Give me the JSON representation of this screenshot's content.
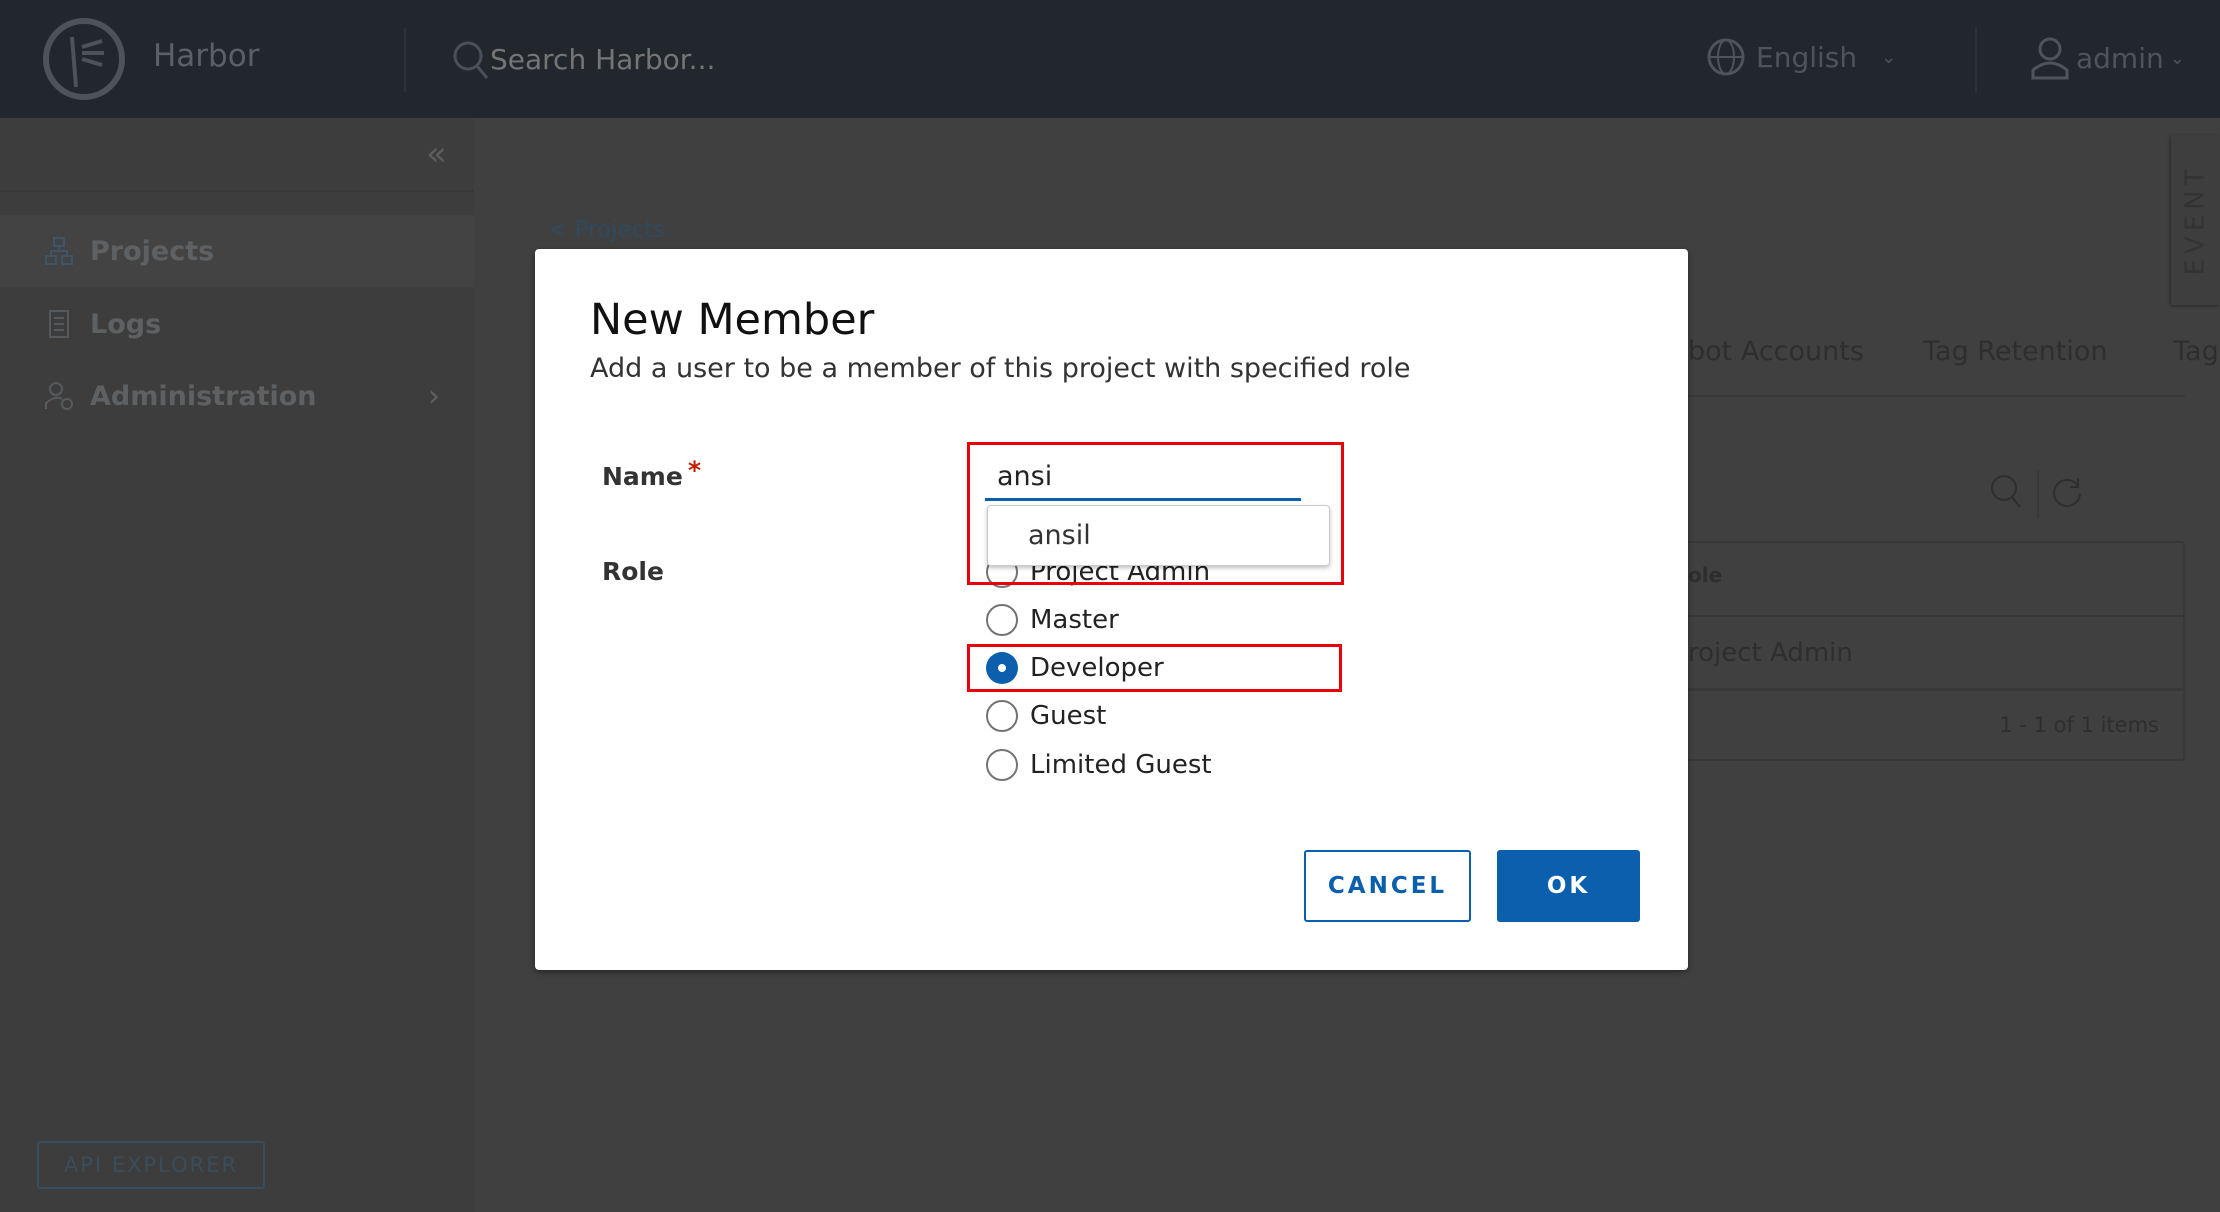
{
  "header": {
    "app_name": "Harbor",
    "search_placeholder": "Search Harbor...",
    "language": "English",
    "user": "admin"
  },
  "sidebar": {
    "items": [
      {
        "label": "Projects",
        "icon": "projects-icon"
      },
      {
        "label": "Logs",
        "icon": "logs-icon"
      },
      {
        "label": "Administration",
        "icon": "administration-icon"
      }
    ],
    "api_explorer": "API EXPLORER"
  },
  "background": {
    "breadcrumb": "< Projects",
    "event_tab": "EVENT",
    "tabs": [
      "bot Accounts",
      "Tag Retention",
      "Tag"
    ],
    "table": {
      "header_role": "ole",
      "row_role": "roject Admin",
      "footer": "1 - 1 of 1 items"
    }
  },
  "modal": {
    "title": "New Member",
    "subtitle": "Add a user to be a member of this project with specified role",
    "name_label": "Name",
    "required_mark": "*",
    "name_value": "ansi",
    "suggestion": "ansil",
    "role_label": "Role",
    "roles": [
      {
        "label": "Project Admin",
        "selected": false
      },
      {
        "label": "Master",
        "selected": false
      },
      {
        "label": "Developer",
        "selected": true
      },
      {
        "label": "Guest",
        "selected": false
      },
      {
        "label": "Limited Guest",
        "selected": false
      }
    ],
    "cancel": "CANCEL",
    "ok": "OK"
  },
  "colors": {
    "primary": "#0b5fac",
    "highlight": "#e8000b",
    "header": "#21272d"
  }
}
